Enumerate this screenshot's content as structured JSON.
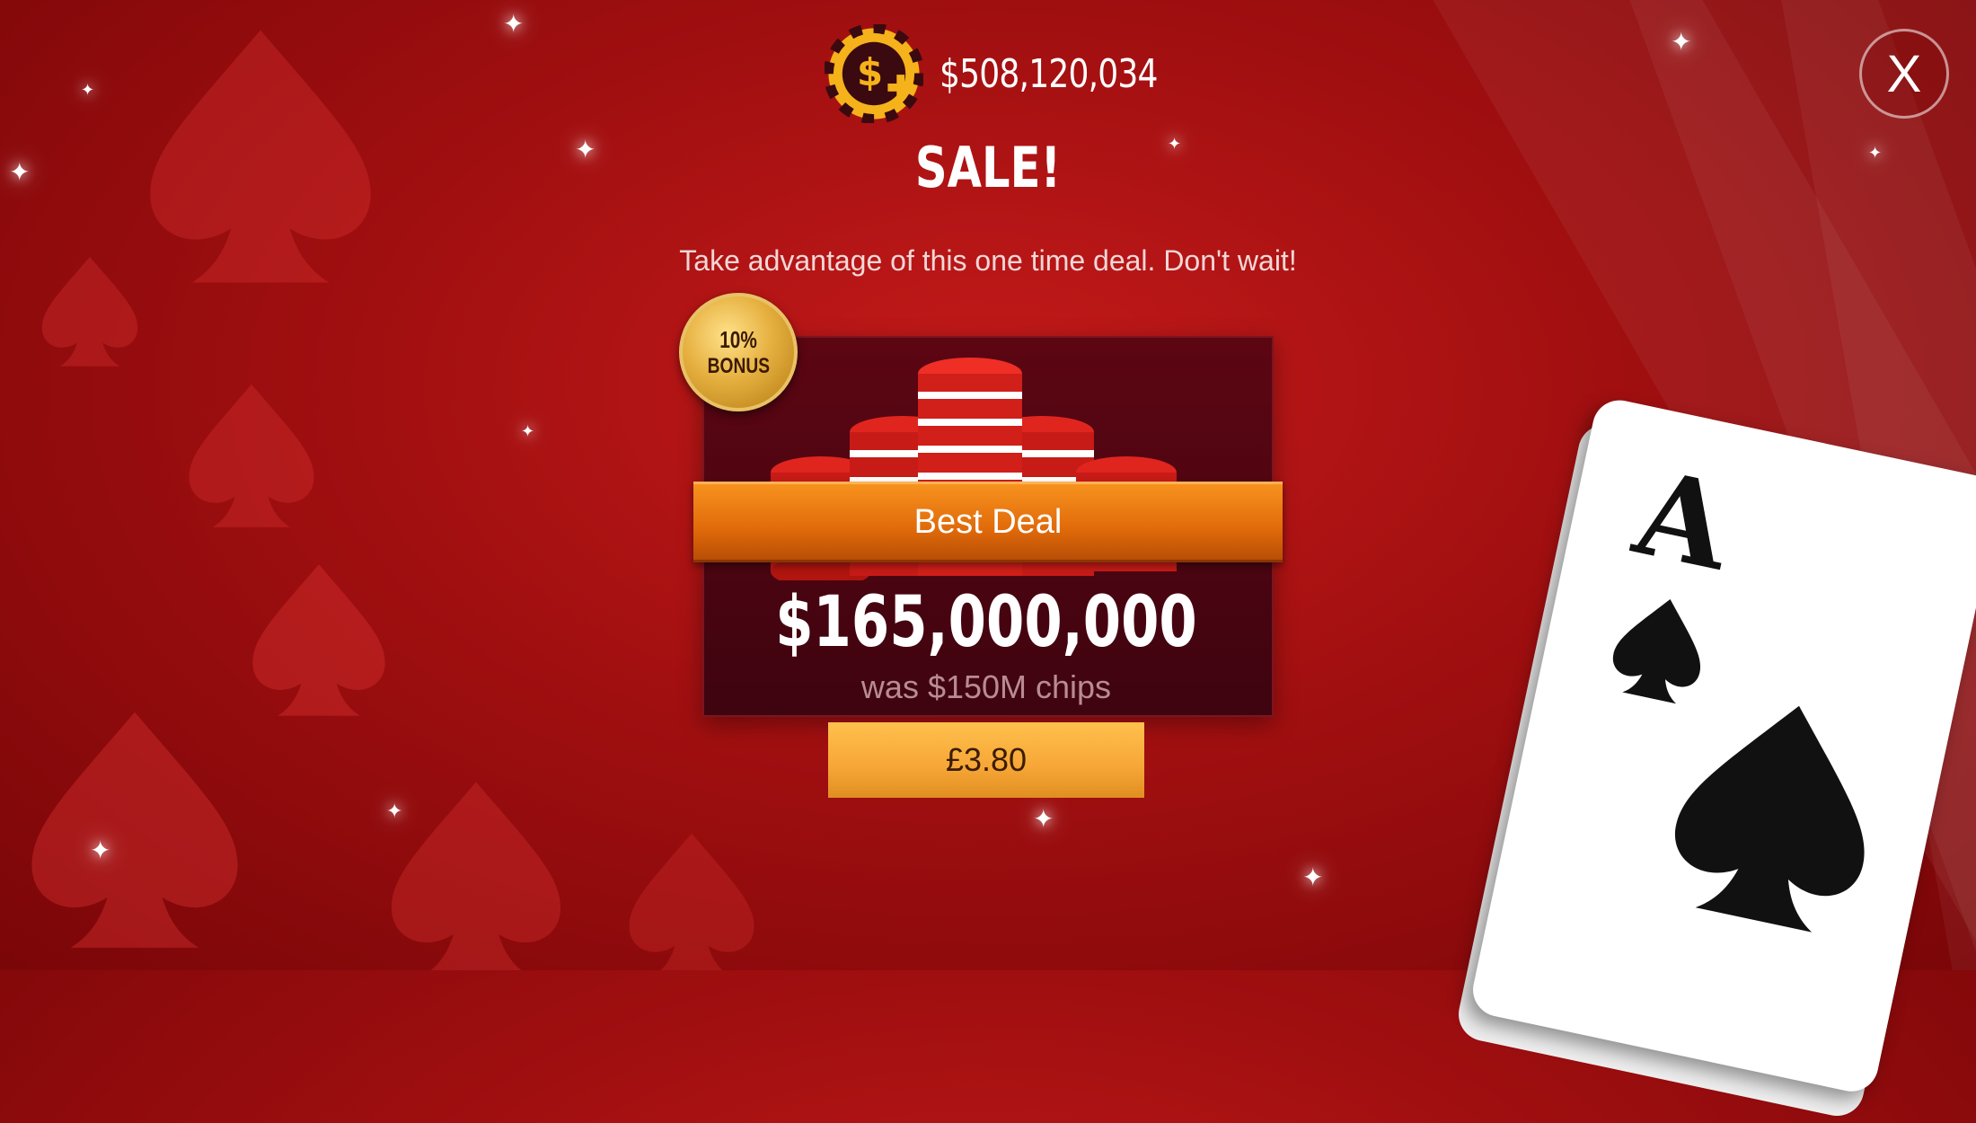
{
  "header": {
    "balance": "$508,120,034",
    "chip_icon": "dollar-chip-plus-icon",
    "close_label": "X"
  },
  "offer": {
    "title": "SALE!",
    "subtitle": "Take advantage of this one time deal. Don't wait!",
    "bonus_line1": "10%",
    "bonus_line2": "BONUS",
    "ribbon": "Best Deal",
    "amount": "$165,000,000",
    "was": "was $150M chips",
    "price": "£3.80"
  },
  "decor": {
    "card_rank": "A",
    "card_suit": "spade",
    "colors": {
      "background": "#a10f10",
      "ribbon": "#e06a0a",
      "button": "#f6a636",
      "badge": "#e6b040"
    }
  }
}
